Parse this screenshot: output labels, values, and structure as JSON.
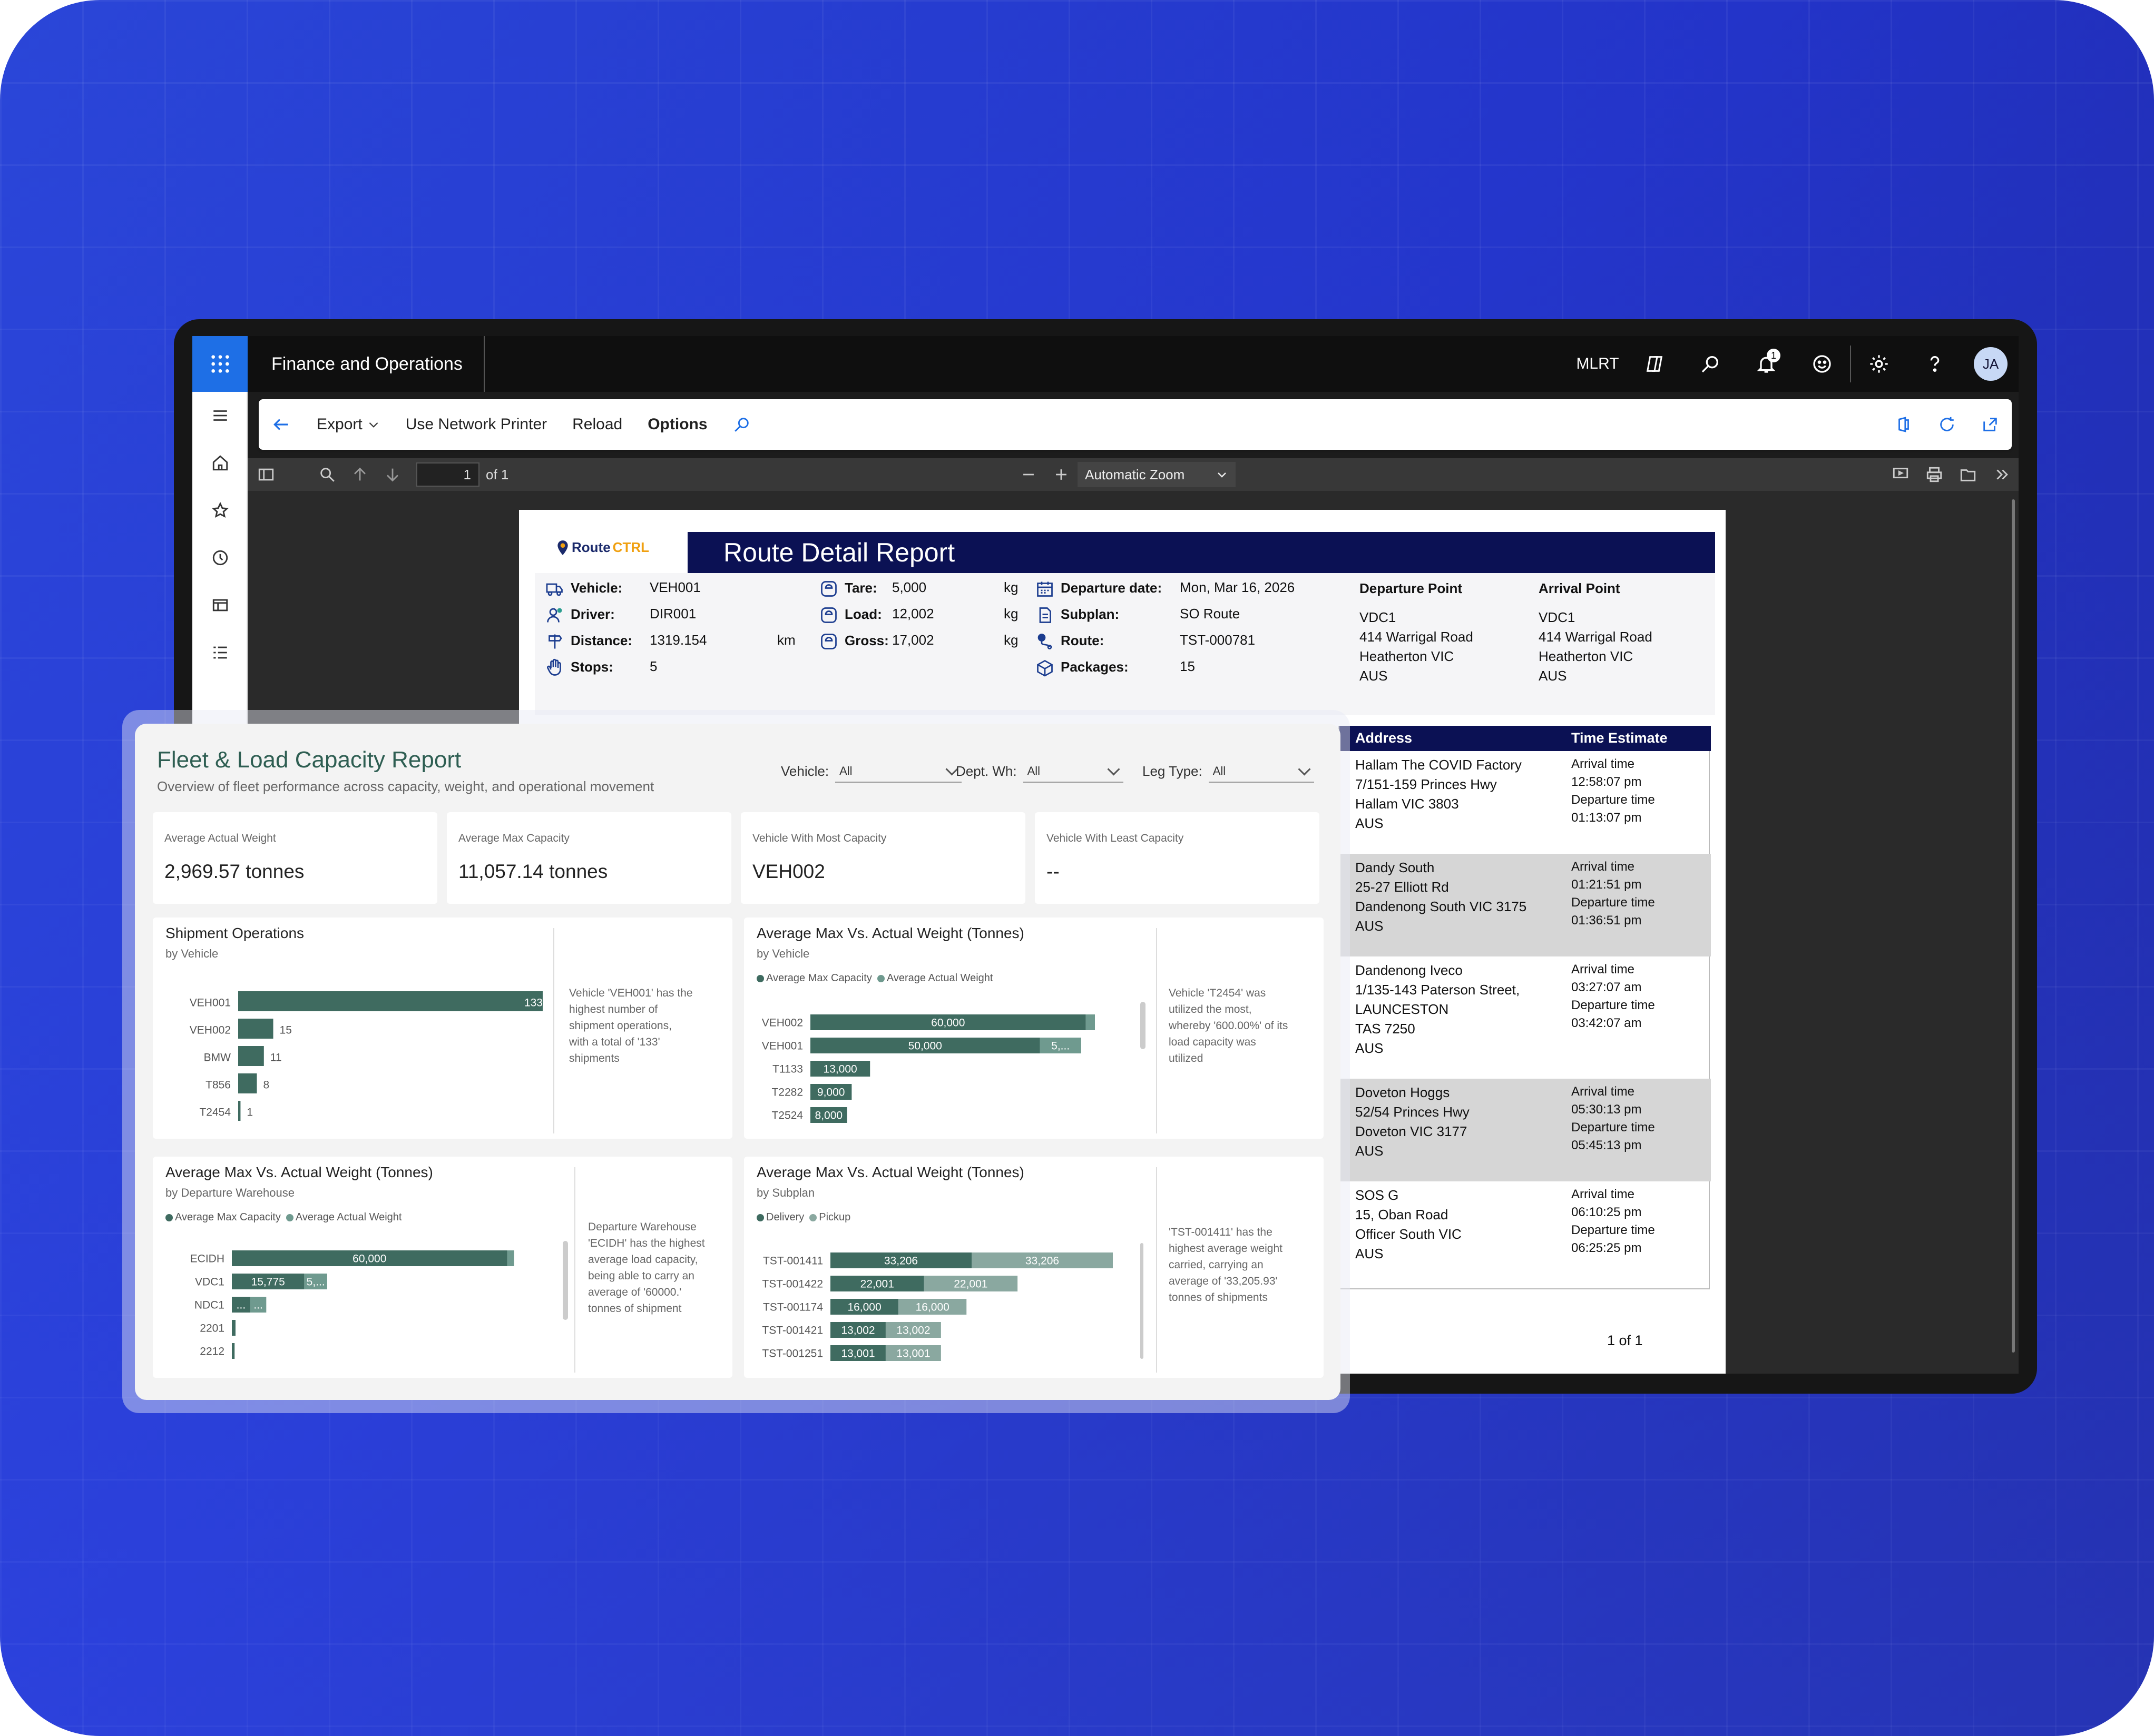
{
  "app": {
    "title": "Finance and Operations",
    "company": "MLRT",
    "notification_count": "1",
    "user_initials": "JA"
  },
  "actions": {
    "export": "Export",
    "network_printer": "Use Network Printer",
    "reload": "Reload",
    "options": "Options"
  },
  "pdf": {
    "page_current": "1",
    "page_of": "of 1",
    "zoom": "Automatic Zoom"
  },
  "report": {
    "title": "Route Detail Report",
    "logo_route": "Route",
    "logo_ctrl": "CTRL",
    "vehicle_label": "Vehicle:",
    "vehicle": "VEH001",
    "driver_label": "Driver:",
    "driver": "DIR001",
    "distance_label": "Distance:",
    "distance": "1319.154",
    "distance_unit": "km",
    "stops_label": "Stops:",
    "stops": "5",
    "tare_label": "Tare:",
    "tare": "5,000",
    "load_label": "Load:",
    "load": "12,002",
    "gross_label": "Gross:",
    "gross": "17,002",
    "kg": "kg",
    "departure_date_label": "Departure date:",
    "departure_date": "Mon, Mar 16, 2026",
    "subplan_label": "Subplan:",
    "subplan": "SO Route",
    "route_label": "Route:",
    "route": "TST-000781",
    "packages_label": "Packages:",
    "packages": "15",
    "departure_point_label": "Departure Point",
    "departure_point": [
      "VDC1",
      "414 Warrigal Road",
      "Heatherton VIC",
      "AUS"
    ],
    "arrival_point_label": "Arrival Point",
    "arrival_point": [
      "VDC1",
      "414 Warrigal Road",
      "Heatherton VIC",
      "AUS"
    ],
    "stops_header_address": "Address",
    "stops_header_time": "Time Estimate",
    "stop_rows": [
      {
        "addr": [
          "Hallam The COVID Factory",
          "7/151-159 Princes Hwy",
          "Hallam VIC 3803",
          "AUS"
        ],
        "arrival_label": "Arrival time",
        "arrival": "12:58:07 pm",
        "departure_label": "Departure time",
        "departure": "01:13:07 pm"
      },
      {
        "addr": [
          "Dandy South",
          "25-27 Elliott Rd",
          "Dandenong South VIC 3175",
          "AUS"
        ],
        "arrival_label": "Arrival time",
        "arrival": "01:21:51 pm",
        "departure_label": "Departure time",
        "departure": "01:36:51 pm"
      },
      {
        "addr": [
          "Dandenong Iveco",
          "1/135-143 Paterson Street,",
          "LAUNCESTON",
          "TAS 7250",
          "AUS"
        ],
        "arrival_label": "Arrival time",
        "arrival": "03:27:07 am",
        "departure_label": "Departure time",
        "departure": "03:42:07 am"
      },
      {
        "addr": [
          "Doveton Hoggs",
          "52/54 Princes Hwy",
          "Doveton VIC 3177",
          "AUS"
        ],
        "arrival_label": "Arrival time",
        "arrival": "05:30:13 pm",
        "departure_label": "Departure time",
        "departure": "05:45:13 pm"
      },
      {
        "addr": [
          "SOS G",
          "15, Oban Road",
          "Officer South VIC",
          "AUS"
        ],
        "arrival_label": "Arrival time",
        "arrival": "06:10:25 pm",
        "departure_label": "Departure time",
        "departure": "06:25:25 pm"
      }
    ],
    "page_footer": "1  of  1"
  },
  "fleet": {
    "title": "Fleet & Load Capacity Report",
    "subtitle": "Overview of fleet performance across capacity, weight, and operational movement",
    "filters": [
      {
        "label": "Vehicle:",
        "value": "All"
      },
      {
        "label": "Dept. Wh:",
        "value": "All"
      },
      {
        "label": "Leg Type:",
        "value": "All"
      }
    ],
    "kpis": [
      {
        "label": "Average Actual Weight",
        "value": "2,969.57 tonnes"
      },
      {
        "label": "Average Max Capacity",
        "value": "11,057.14 tonnes"
      },
      {
        "label": "Vehicle With Most Capacity",
        "value": "VEH002"
      },
      {
        "label": "Vehicle With Least Capacity",
        "value": "--"
      }
    ],
    "cards": [
      {
        "title": "Shipment Operations",
        "subtitle": "by Vehicle",
        "note": [
          "Vehicle 'VEH001' has the",
          "highest number of",
          "shipment operations,",
          "with a total of '133'",
          "shipments"
        ]
      },
      {
        "title": "Average Max Vs. Actual Weight (Tonnes)",
        "subtitle": "by Vehicle",
        "legend": [
          "Average Max Capacity",
          "Average Actual Weight"
        ],
        "note": [
          "Vehicle 'T2454' was",
          "utilized the most,",
          "whereby '600.00%' of its",
          "load capacity was",
          "utilized"
        ]
      },
      {
        "title": "Average Max Vs. Actual Weight (Tonnes)",
        "subtitle": "by Departure Warehouse",
        "legend": [
          "Average Max Capacity",
          "Average Actual Weight"
        ],
        "note": [
          "Departure Warehouse",
          "'ECIDH' has the highest",
          "average load capacity,",
          "being able to carry an",
          "average of '60000.'",
          "tonnes of shipment"
        ]
      },
      {
        "title": "Average Max Vs. Actual Weight (Tonnes)",
        "subtitle": "by Subplan",
        "legend": [
          "Delivery",
          "Pickup"
        ],
        "note": [
          "'TST-001411' has the",
          "highest average weight",
          "carried, carrying an",
          "average of '33,205.93'",
          "tonnes of shipments"
        ]
      }
    ]
  },
  "chart_data": [
    {
      "type": "bar",
      "title": "Shipment Operations",
      "subtitle": "by Vehicle",
      "categories": [
        "VEH001",
        "VEH002",
        "BMW",
        "T856",
        "T2454"
      ],
      "values": [
        133,
        15,
        11,
        8,
        1
      ],
      "labels": [
        "133",
        "15",
        "11",
        "8",
        "1"
      ]
    },
    {
      "type": "bar",
      "title": "Average Max Vs. Actual Weight (Tonnes)",
      "subtitle": "by Vehicle",
      "categories": [
        "VEH002",
        "VEH001",
        "T1133",
        "T2282",
        "T2524"
      ],
      "series": [
        {
          "name": "Average Max Capacity",
          "values": [
            60000,
            50000,
            13000,
            9000,
            8000
          ],
          "labels": [
            "60,000",
            "50,000",
            "13,000",
            "9,000",
            "8,000"
          ]
        },
        {
          "name": "Average Actual Weight",
          "values": [
            2000,
            9000,
            0,
            0,
            0
          ],
          "labels": [
            "",
            "5,...",
            "",
            "",
            ""
          ]
        }
      ]
    },
    {
      "type": "bar",
      "title": "Average Max Vs. Actual Weight (Tonnes)",
      "subtitle": "by Departure Warehouse",
      "categories": [
        "ECIDH",
        "VDC1",
        "NDC1",
        "2201",
        "2212"
      ],
      "series": [
        {
          "name": "Average Max Capacity",
          "values": [
            60000,
            15775,
            4000,
            800,
            600
          ],
          "labels": [
            "60,000",
            "15,775",
            "...",
            "",
            ""
          ]
        },
        {
          "name": "Average Actual Weight",
          "values": [
            1500,
            5000,
            3500,
            0,
            0
          ],
          "labels": [
            "",
            "5,...",
            "...",
            "",
            ""
          ]
        }
      ]
    },
    {
      "type": "bar",
      "title": "Average Max Vs. Actual Weight (Tonnes)",
      "subtitle": "by Subplan",
      "categories": [
        "TST-001411",
        "TST-001422",
        "TST-001174",
        "TST-001421",
        "TST-001251"
      ],
      "series": [
        {
          "name": "Delivery",
          "values": [
            33206,
            22001,
            16000,
            13002,
            13001
          ],
          "labels": [
            "33,206",
            "22,001",
            "16,000",
            "13,002",
            "13,001"
          ]
        },
        {
          "name": "Pickup",
          "values": [
            33206,
            22001,
            16000,
            13002,
            13001
          ],
          "labels": [
            "33,206",
            "22,001",
            "16,000",
            "13,002",
            "13,001"
          ]
        }
      ]
    }
  ],
  "colors": {
    "primary_bar": "#3f6b60",
    "secondary_bar": "#8aa8a0",
    "navy": "#0b1154",
    "brand": "#1e6fe6"
  }
}
